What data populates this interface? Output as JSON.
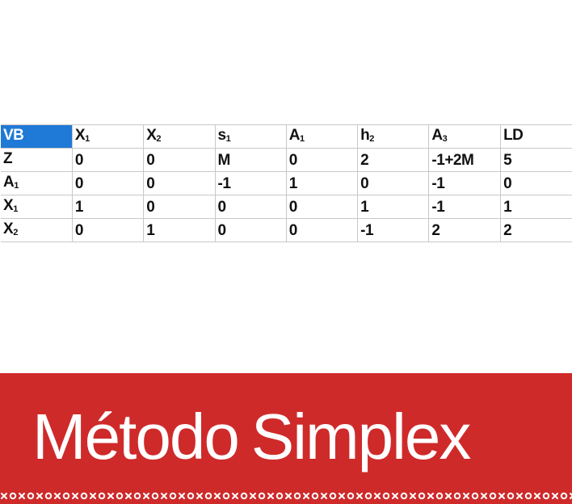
{
  "tableau": {
    "header": [
      {
        "base": "VB",
        "sub": ""
      },
      {
        "base": "X",
        "sub": "1"
      },
      {
        "base": "X",
        "sub": "2"
      },
      {
        "base": "s",
        "sub": "1"
      },
      {
        "base": "A",
        "sub": "1"
      },
      {
        "base": "h",
        "sub": "2"
      },
      {
        "base": "A",
        "sub": "3"
      },
      {
        "base": "LD",
        "sub": ""
      }
    ],
    "rows": [
      {
        "label": {
          "base": "Z",
          "sub": ""
        },
        "cells": [
          "0",
          "0",
          "M",
          "0",
          "2",
          "-1+2M",
          "5"
        ]
      },
      {
        "label": {
          "base": "A",
          "sub": "1"
        },
        "cells": [
          "0",
          "0",
          "-1",
          "1",
          "0",
          "-1",
          "0"
        ]
      },
      {
        "label": {
          "base": "X",
          "sub": "1"
        },
        "cells": [
          "1",
          "0",
          "0",
          "0",
          "1",
          "-1",
          "1"
        ]
      },
      {
        "label": {
          "base": "X",
          "sub": "2"
        },
        "cells": [
          "0",
          "1",
          "0",
          "0",
          "-1",
          "2",
          "2"
        ]
      }
    ]
  },
  "banner": {
    "title_word1": "Método",
    "title_word2": "Simplex"
  },
  "colors": {
    "banner_red": "#cf2a2a",
    "selected_cell": "#1f79d6"
  }
}
